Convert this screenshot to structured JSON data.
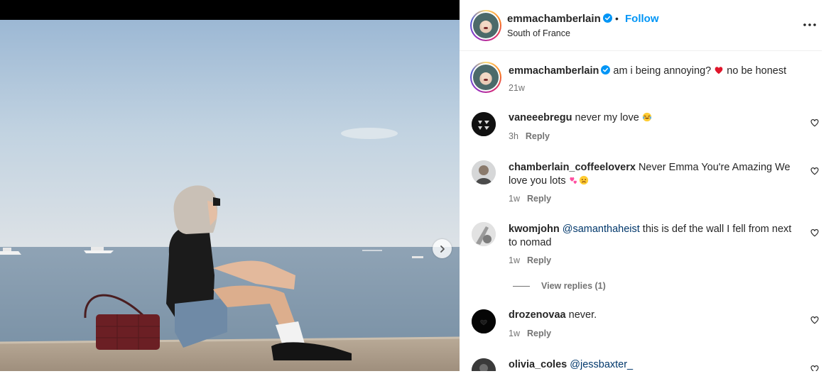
{
  "post": {
    "author": "emmachamberlain",
    "location": "South of France",
    "follow_label": "Follow",
    "separator": "•",
    "more_icon": "more-horizontal-icon"
  },
  "caption": {
    "username": "emmachamberlain",
    "text": "am i being annoying?",
    "text_after": "no be honest",
    "emoji": "red-heart",
    "time": "21w"
  },
  "comments": [
    {
      "username": "vaneeebregu",
      "text": "never my love",
      "emoji": "laughing-crying",
      "time": "3h",
      "reply_label": "Reply"
    },
    {
      "username": "chamberlain_coffeeloverx",
      "text": "Never Emma You're Amazing We love you lots",
      "emoji": "hearts-and-sad",
      "time": "1w",
      "reply_label": "Reply"
    },
    {
      "username": "kwomjohn",
      "mention": "@samanthaheist",
      "text": "this is def the wall I fell from next to nomad",
      "time": "1w",
      "reply_label": "Reply",
      "view_replies": "View replies (1)"
    },
    {
      "username": "drozenovaa",
      "text": "never.",
      "time": "1w",
      "reply_label": "Reply"
    },
    {
      "username": "olivia_coles",
      "mention": "@jessbaxter_",
      "text": ""
    }
  ],
  "colors": {
    "link_blue": "#0095f6",
    "mention_blue": "#00376b",
    "muted_gray": "#737373",
    "verified_blue": "#0095f6"
  }
}
